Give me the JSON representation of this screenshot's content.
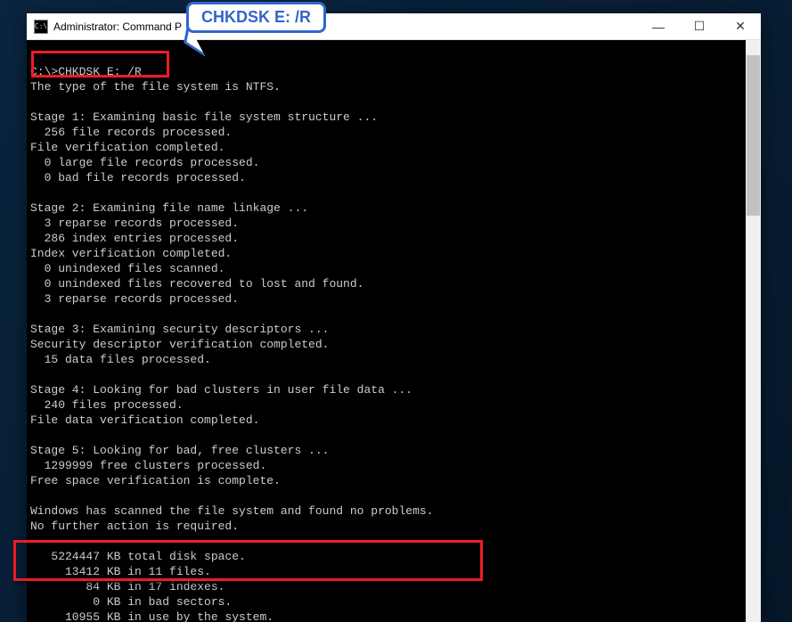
{
  "titlebar": {
    "icon_text": "C:\\",
    "title": "Administrator: Command P",
    "min": "—",
    "max": "☐",
    "close": "✕"
  },
  "callout": {
    "text": "CHKDSK E: /R"
  },
  "terminal": {
    "lines": [
      "",
      "C:\\>CHKDSK E: /R",
      "The type of the file system is NTFS.",
      "",
      "Stage 1: Examining basic file system structure ...",
      "  256 file records processed.",
      "File verification completed.",
      "  0 large file records processed.",
      "  0 bad file records processed.",
      "",
      "Stage 2: Examining file name linkage ...",
      "  3 reparse records processed.",
      "  286 index entries processed.",
      "Index verification completed.",
      "  0 unindexed files scanned.",
      "  0 unindexed files recovered to lost and found.",
      "  3 reparse records processed.",
      "",
      "Stage 3: Examining security descriptors ...",
      "Security descriptor verification completed.",
      "  15 data files processed.",
      "",
      "Stage 4: Looking for bad clusters in user file data ...",
      "  240 files processed.",
      "File data verification completed.",
      "",
      "Stage 5: Looking for bad, free clusters ...",
      "  1299999 free clusters processed.",
      "Free space verification is complete.",
      "",
      "Windows has scanned the file system and found no problems.",
      "No further action is required.",
      "",
      "   5224447 KB total disk space.",
      "     13412 KB in 11 files.",
      "        84 KB in 17 indexes.",
      "         0 KB in bad sectors.",
      "     10955 KB in use by the system."
    ]
  }
}
